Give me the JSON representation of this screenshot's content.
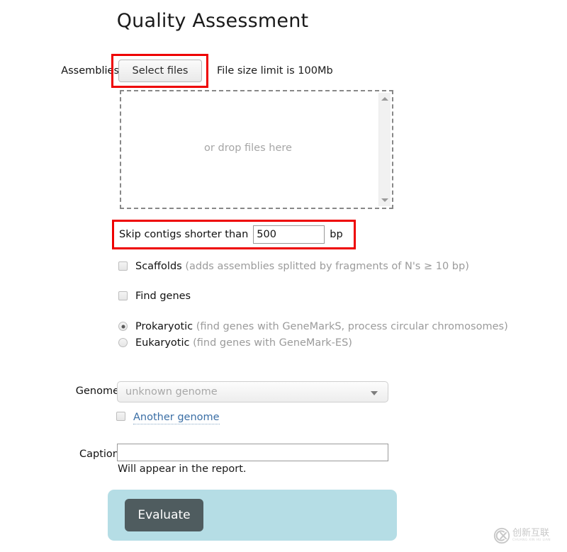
{
  "page": {
    "title": "Quality Assessment"
  },
  "assemblies": {
    "label": "Assemblies",
    "select_files_button": "Select files",
    "file_size_note": "File size limit is 100Mb",
    "dropzone_text": "or drop files here",
    "scrollbar_up_icon": "triangle-up-icon",
    "scrollbar_down_icon": "triangle-down-icon"
  },
  "skip_contigs": {
    "prefix_label": "Skip contigs shorter than",
    "value": "500",
    "placeholder": "",
    "unit_label": "bp"
  },
  "options": {
    "scaffolds": {
      "label": "Scaffolds",
      "hint": "(adds assemblies splitted by fragments of N's ≥ 10 bp)",
      "checked": false
    },
    "find_genes": {
      "label": "Find genes",
      "hint": "",
      "checked": false
    },
    "gene_type": {
      "selected": "Prokaryotic",
      "choices": [
        {
          "label": "Prokaryotic",
          "hint": "(find genes with GeneMarkS, process circular chromosomes)",
          "selected": true
        },
        {
          "label": "Eukaryotic",
          "hint": "(find genes with GeneMark-ES)",
          "selected": false
        }
      ]
    }
  },
  "genome": {
    "label": "Genome",
    "selected_option": "unknown genome",
    "dropdown_icon": "chevron-down-icon",
    "another_genome_label": "Another genome",
    "another_genome_checked": false
  },
  "caption": {
    "label": "Caption",
    "value": "",
    "placeholder": "",
    "note": "Will appear in the report."
  },
  "actions": {
    "evaluate_button": "Evaluate"
  },
  "annotations": {
    "highlight_color": "#ee0000",
    "highlighted_regions": [
      "select-files-button",
      "skip-contigs-row"
    ]
  },
  "watermark": {
    "chinese_text": "创新互联",
    "pinyin_text": "CHUANG XIN HU LIAN",
    "logo_icon": "cx-logo-icon"
  },
  "theme": {
    "accent_panel": "#b5dde5",
    "button_dark": "#4f5c5f",
    "link_blue": "#3a6ea5",
    "muted_text": "#9b9b9b"
  }
}
